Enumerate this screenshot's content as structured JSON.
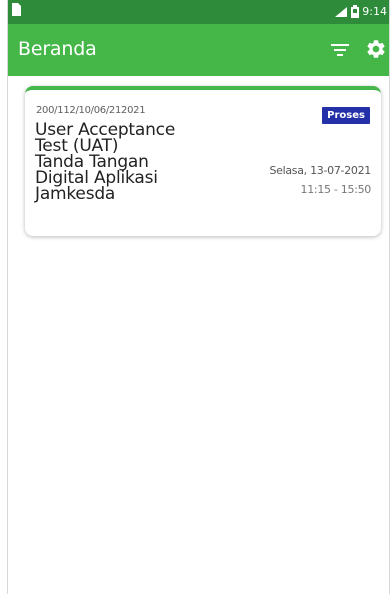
{
  "status_bar": {
    "time": "9:14",
    "icons": [
      "sim-card-icon",
      "signal-icon",
      "battery-icon"
    ]
  },
  "toolbar": {
    "title": "Beranda",
    "filter_icon": "filter-icon",
    "settings_icon": "gear-icon"
  },
  "colors": {
    "primary": "#45b749",
    "primary_dark": "#2e8b3a",
    "badge": "#2330a8"
  },
  "cards": [
    {
      "number": "200/112/10/06/212021",
      "title": "User Acceptance\nTest (UAT)\nTanda Tangan\nDigital Aplikasi\nJamkesda",
      "status": "Proses",
      "date": "Selasa, 13-07-2021",
      "time": "11:15 - 15:50"
    }
  ]
}
